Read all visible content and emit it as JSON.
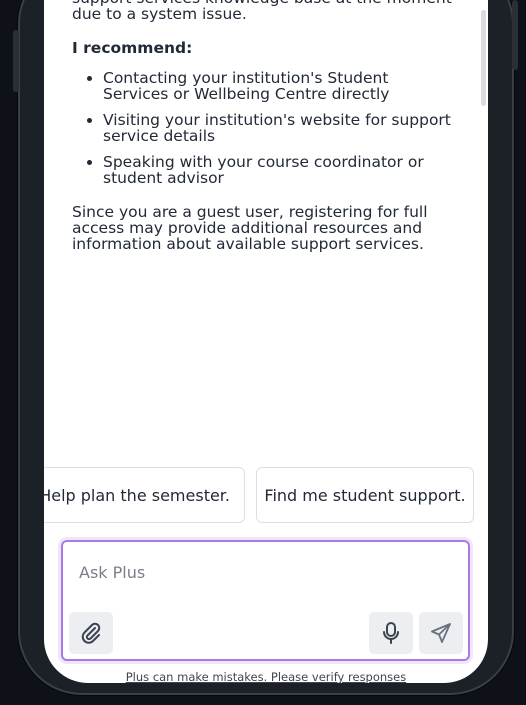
{
  "message": {
    "intro": "support services knowledge base at the moment due to a system issue.",
    "heading": "I recommend:",
    "recommendations": [
      "Contacting your institution's Student Services or Wellbeing Centre directly",
      "Visiting your institution's website for support service details",
      "Speaking with your course coordinator or student advisor"
    ],
    "closing": "Since you are a guest user, registering for full access may provide additional resources and information about available support services."
  },
  "suggestions": [
    {
      "label": "Help plan the semester."
    },
    {
      "label": "Find me student support."
    }
  ],
  "composer": {
    "placeholder": "Ask Plus",
    "value": ""
  },
  "icons": {
    "attach": "paperclip-icon",
    "mic": "microphone-icon",
    "send": "send-icon"
  },
  "disclaimer": "Plus can make mistakes. Please verify responses",
  "colors": {
    "accent": "#a77be0",
    "text": "#222a38",
    "frame": "#1c2027"
  }
}
